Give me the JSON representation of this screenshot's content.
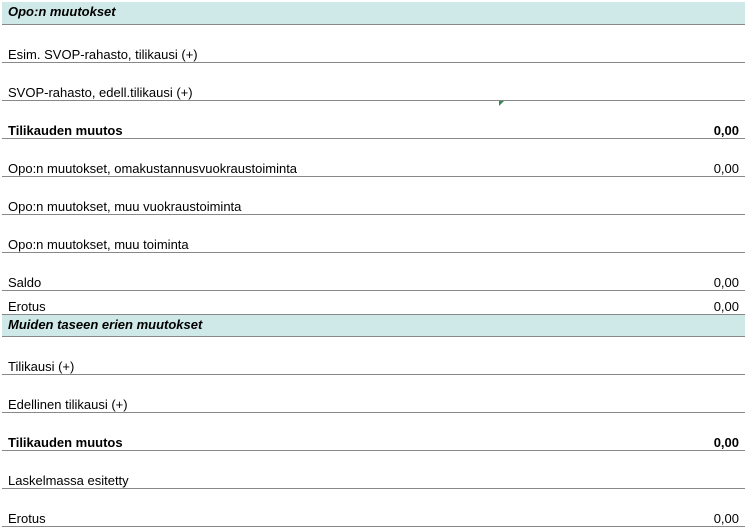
{
  "section1": {
    "header": "Opo:n muutokset",
    "row1": "Esim. SVOP-rahasto, tilikausi (+)",
    "row2": "SVOP-rahasto, edell.tilikausi (+)",
    "muutos_label": "Tilikauden muutos",
    "muutos_value": "0,00",
    "row4": "Opo:n muutokset, omakustannusvuokraustoiminta",
    "row4_value": "0,00",
    "row5": "Opo:n muutokset, muu vuokraustoiminta",
    "row6": "Opo:n muutokset, muu toiminta",
    "saldo_label": "Saldo",
    "saldo_value": "0,00",
    "erotus_label": "Erotus",
    "erotus_value": "0,00"
  },
  "section2": {
    "header": "Muiden taseen erien muutokset",
    "row1": "Tilikausi (+)",
    "row2": "Edellinen tilikausi (+)",
    "muutos_label": "Tilikauden muutos",
    "muutos_value": "0,00",
    "lask_label": "Laskelmassa esitetty",
    "erotus_label": "Erotus",
    "erotus_value": "0,00"
  }
}
